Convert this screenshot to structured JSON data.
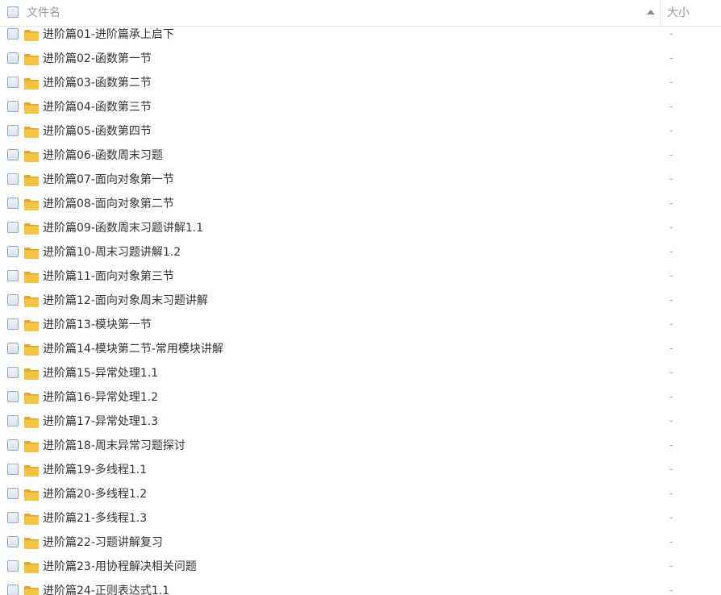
{
  "header": {
    "name_label": "文件名",
    "size_label": "大小",
    "sort": "ascending"
  },
  "icons": {
    "folder": "folder-icon",
    "sort": "sort-up-icon",
    "checkbox": "checkbox"
  },
  "colors": {
    "folder": "#f6c33c",
    "folder_dark": "#e0a52a",
    "checkbox_border": "#8fa7c1"
  },
  "files": [
    {
      "name": "进阶篇01-进阶篇承上启下",
      "size": "-"
    },
    {
      "name": "进阶篇02-函数第一节",
      "size": "-"
    },
    {
      "name": "进阶篇03-函数第二节",
      "size": "-"
    },
    {
      "name": "进阶篇04-函数第三节",
      "size": "-"
    },
    {
      "name": "进阶篇05-函数第四节",
      "size": "-"
    },
    {
      "name": "进阶篇06-函数周末习题",
      "size": "-"
    },
    {
      "name": "进阶篇07-面向对象第一节",
      "size": "-"
    },
    {
      "name": "进阶篇08-面向对象第二节",
      "size": "-"
    },
    {
      "name": "进阶篇09-函数周末习题讲解1.1",
      "size": "-"
    },
    {
      "name": "进阶篇10-周末习题讲解1.2",
      "size": "-"
    },
    {
      "name": "进阶篇11-面向对象第三节",
      "size": "-"
    },
    {
      "name": "进阶篇12-面向对象周末习题讲解",
      "size": "-"
    },
    {
      "name": "进阶篇13-模块第一节",
      "size": "-"
    },
    {
      "name": "进阶篇14-模块第二节-常用模块讲解",
      "size": "-"
    },
    {
      "name": "进阶篇15-异常处理1.1",
      "size": "-"
    },
    {
      "name": "进阶篇16-异常处理1.2",
      "size": "-"
    },
    {
      "name": "进阶篇17-异常处理1.3",
      "size": "-"
    },
    {
      "name": "进阶篇18-周末异常习题探讨",
      "size": "-"
    },
    {
      "name": "进阶篇19-多线程1.1",
      "size": "-"
    },
    {
      "name": "进阶篇20-多线程1.2",
      "size": "-"
    },
    {
      "name": "进阶篇21-多线程1.3",
      "size": "-"
    },
    {
      "name": "进阶篇22-习题讲解复习",
      "size": "-"
    },
    {
      "name": "进阶篇23-用协程解决相关问题",
      "size": "-"
    },
    {
      "name": "进阶篇24-正则表达式1.1",
      "size": "-"
    }
  ]
}
